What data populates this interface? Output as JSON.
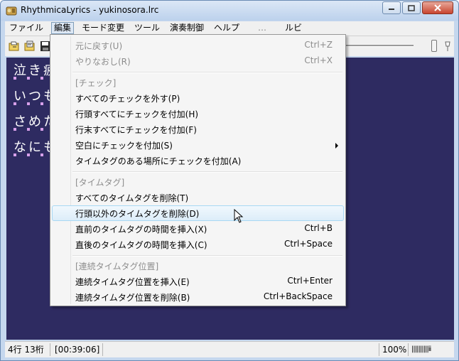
{
  "window": {
    "title": "RhythmicaLyrics - yukinosora.lrc"
  },
  "menubar": {
    "items": [
      "ファイル",
      "編集",
      "モード変更",
      "ツール",
      "演奏制御",
      "ヘルプ",
      "…",
      "ルビ"
    ]
  },
  "editor": {
    "lines": [
      "泣き疲",
      "いつも",
      "さめた",
      "なにも"
    ]
  },
  "statusbar": {
    "position": "4行 13桁",
    "time": "[00:39:06]",
    "zoom": "100%",
    "meter": "||||||||||ii"
  },
  "edit_menu": {
    "undo": {
      "label": "元に戻す(U)",
      "shortcut": "Ctrl+Z"
    },
    "redo": {
      "label": "やりなおし(R)",
      "shortcut": "Ctrl+X"
    },
    "check_header": "[チェック]",
    "remove_all_checks": "すべてのチェックを外す(P)",
    "check_line_starts": "行頭すべてにチェックを付加(H)",
    "check_line_ends": "行末すべてにチェックを付加(F)",
    "check_blanks": "空白にチェックを付加(S)",
    "check_timetags": "タイムタグのある場所にチェックを付加(A)",
    "timetag_header": "[タイムタグ]",
    "delete_all_timetags": "すべてのタイムタグを削除(T)",
    "delete_non_head_timetags": "行頭以外のタイムタグを削除(D)",
    "insert_prev_time": {
      "label": "直前のタイムタグの時間を挿入(X)",
      "shortcut": "Ctrl+B"
    },
    "insert_next_time": {
      "label": "直後のタイムタグの時間を挿入(C)",
      "shortcut": "Ctrl+Space"
    },
    "continuous_header": "[連続タイムタグ位置]",
    "insert_continuous": {
      "label": "連続タイムタグ位置を挿入(E)",
      "shortcut": "Ctrl+Enter"
    },
    "delete_continuous": {
      "label": "連続タイムタグ位置を削除(B)",
      "shortcut": "Ctrl+BackSpace"
    }
  },
  "colors": {
    "editor_background": "#2e2b61",
    "editor_text": "#ffffff",
    "tick_marker": "#d7a0ea",
    "menu_highlight": "#dcedf9"
  },
  "icons": [
    "app-icon",
    "minimize-icon",
    "maximize-icon",
    "close-icon",
    "open-file-icon",
    "open-lyrics-icon",
    "save-icon",
    "submenu-arrow-icon",
    "mouse-cursor-icon"
  ]
}
